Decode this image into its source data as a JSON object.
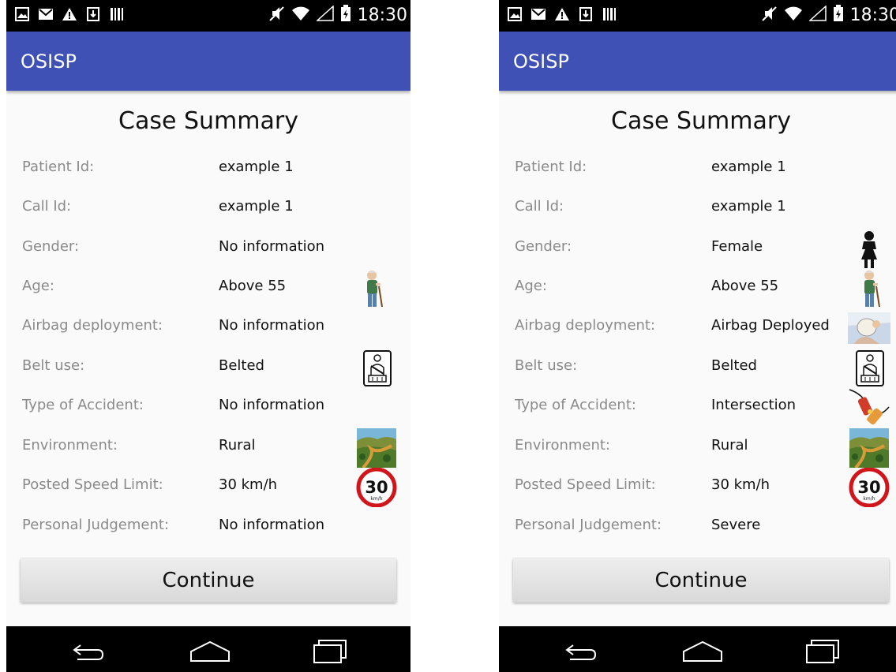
{
  "status_bar": {
    "time": "18:30"
  },
  "app": {
    "title": "OSISP"
  },
  "screens": [
    {
      "title": "Case Summary",
      "rows": [
        {
          "label": "Patient Id:",
          "value": "example 1",
          "icon": null
        },
        {
          "label": "Call Id:",
          "value": "example 1",
          "icon": null
        },
        {
          "label": "Gender:",
          "value": "No information",
          "icon": null
        },
        {
          "label": "Age:",
          "value": "Above 55",
          "icon": "elderly-person-icon"
        },
        {
          "label": "Airbag deployment:",
          "value": "No information",
          "icon": null
        },
        {
          "label": "Belt use:",
          "value": "Belted",
          "icon": "seatbelt-icon"
        },
        {
          "label": "Type of Accident:",
          "value": "No information",
          "icon": null
        },
        {
          "label": "Environment:",
          "value": "Rural",
          "icon": "rural-landscape-icon"
        },
        {
          "label": "Posted Speed Limit:",
          "value": "30 km/h",
          "icon": "speed-limit-sign-icon"
        },
        {
          "label": "Personal Judgement:",
          "value": "No information",
          "icon": null
        }
      ],
      "continue_label": "Continue"
    },
    {
      "title": "Case Summary",
      "rows": [
        {
          "label": "Patient Id:",
          "value": "example 1",
          "icon": null
        },
        {
          "label": "Call Id:",
          "value": "example 1",
          "icon": null
        },
        {
          "label": "Gender:",
          "value": "Female",
          "icon": "female-person-icon"
        },
        {
          "label": "Age:",
          "value": "Above 55",
          "icon": "elderly-person-icon"
        },
        {
          "label": "Airbag deployment:",
          "value": "Airbag Deployed",
          "icon": "airbag-icon"
        },
        {
          "label": "Belt use:",
          "value": "Belted",
          "icon": "seatbelt-icon"
        },
        {
          "label": "Type of Accident:",
          "value": "Intersection",
          "icon": "intersection-crash-icon"
        },
        {
          "label": "Environment:",
          "value": "Rural",
          "icon": "rural-landscape-icon"
        },
        {
          "label": "Posted Speed Limit:",
          "value": "30 km/h",
          "icon": "speed-limit-sign-icon"
        },
        {
          "label": "Personal Judgement:",
          "value": "Severe",
          "icon": null
        }
      ],
      "continue_label": "Continue"
    }
  ],
  "speed_sign": {
    "number": "30",
    "unit": "km/h"
  },
  "colors": {
    "app_bar": "#3f51b5",
    "status_bar": "#000000",
    "background": "#fafafa"
  }
}
